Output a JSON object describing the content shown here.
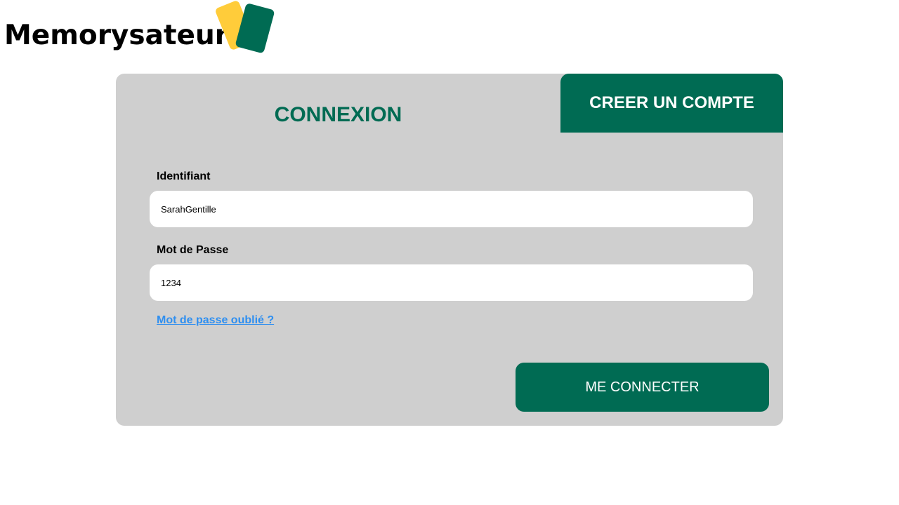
{
  "header": {
    "brand_name": "Memorysateurs",
    "logo_icon": "cards-logo-icon"
  },
  "colors": {
    "accent": "#006b53",
    "card_yellow": "#ffcc3a",
    "panel_bg": "#cfcfcf",
    "link": "#2f8ff0"
  },
  "tabs": {
    "login": "CONNEXION",
    "register": "CREER UN COMPTE"
  },
  "form": {
    "username_label": "Identifiant",
    "username_value": "SarahGentille",
    "password_label": "Mot de Passe",
    "password_value": "1234",
    "forgot_link": "Mot de passe oublié ?",
    "submit_label": "ME CONNECTER"
  }
}
